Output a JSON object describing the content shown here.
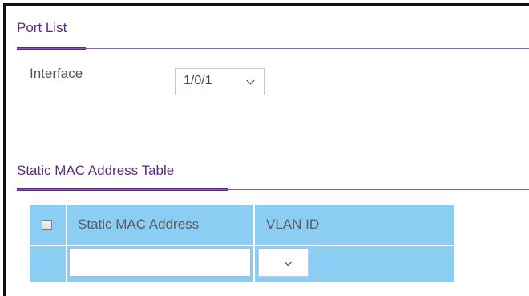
{
  "port_list": {
    "title": "Port List",
    "interface_label": "Interface",
    "interface_value": "1/0/1"
  },
  "static_table": {
    "title": "Static MAC Address Table",
    "columns": {
      "select_all": "",
      "mac": "Static MAC Address",
      "vlan": "VLAN ID"
    },
    "new_row": {
      "mac_value": "",
      "vlan_value": ""
    }
  },
  "colors": {
    "section_title": "#5a2a82",
    "section_rule": "#8a5cad",
    "table_bg": "#8ccdf4"
  },
  "icons": {
    "dropdown": "chevron-down-icon"
  }
}
